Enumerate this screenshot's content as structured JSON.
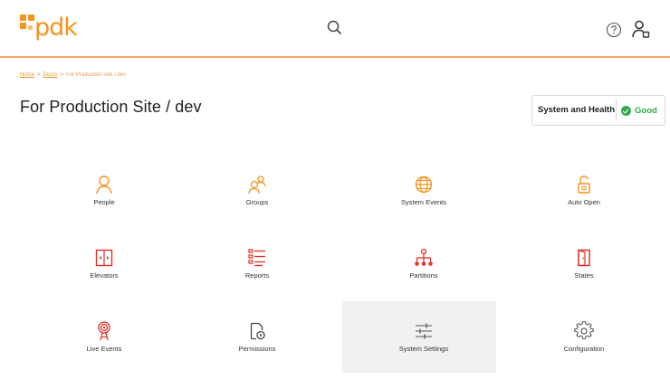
{
  "header": {
    "logo_text": "pdk",
    "search_icon": "search-icon",
    "help_icon": "help-icon",
    "user_icon": "user-icon"
  },
  "breadcrumb": {
    "items": [
      "Home",
      "Doors",
      "For Production Site / dev"
    ]
  },
  "page": {
    "title": "For Production Site / dev"
  },
  "health": {
    "label": "System and Health",
    "status": "Good",
    "status_color": "#2eaa4a"
  },
  "accent_color": "#f7941d",
  "tiles": [
    {
      "label": "People",
      "icon": "person-icon",
      "active": false
    },
    {
      "label": "Groups",
      "icon": "group-icon",
      "active": false
    },
    {
      "label": "System Events",
      "icon": "globe-icon",
      "active": false
    },
    {
      "label": "Auto Open",
      "icon": "unlock-icon",
      "active": false
    },
    {
      "label": "Elevators",
      "icon": "elevator-icon",
      "active": false
    },
    {
      "label": "Reports",
      "icon": "report-icon",
      "active": false
    },
    {
      "label": "Partitions",
      "icon": "hierarchy-icon",
      "active": false
    },
    {
      "label": "States",
      "icon": "door-icon",
      "active": false
    },
    {
      "label": "Live Events",
      "icon": "broadcast-icon",
      "active": false
    },
    {
      "label": "Permissions",
      "icon": "permission-icon",
      "active": false
    },
    {
      "label": "System Settings",
      "icon": "sliders-icon",
      "active": true
    },
    {
      "label": "Configuration",
      "icon": "gear-icon",
      "active": false
    }
  ]
}
